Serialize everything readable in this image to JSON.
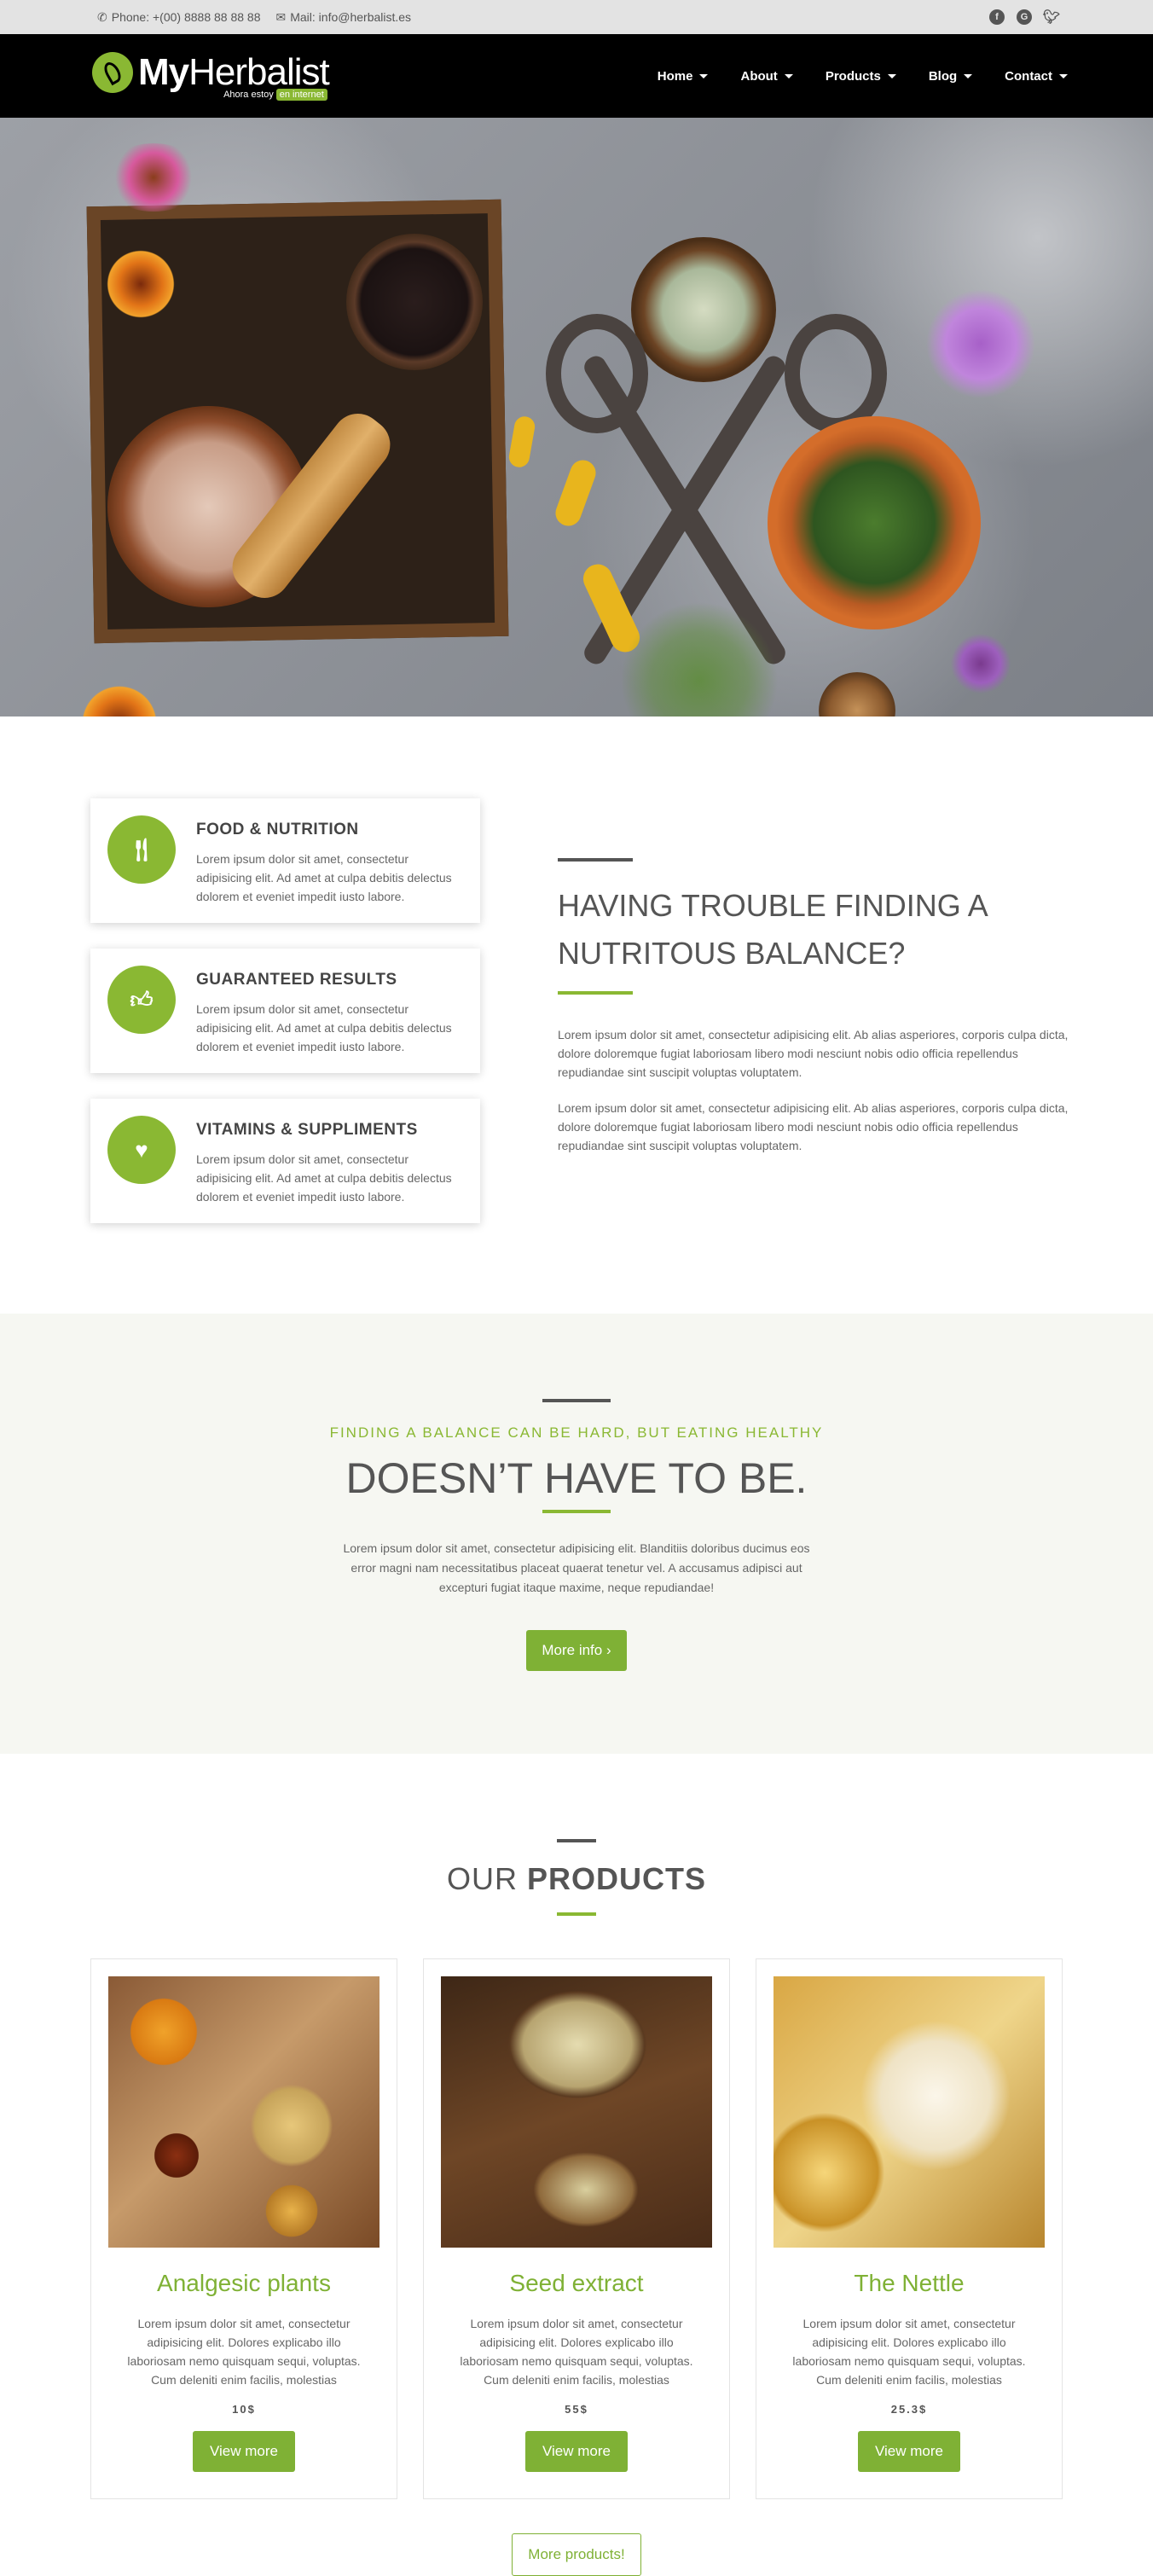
{
  "topbar": {
    "phone": "Phone: +(00) 8888 88 88 88",
    "mail": "Mail: info@herbalist.es"
  },
  "brand": {
    "name_bold": "My",
    "name_light": "Herbalist",
    "tagline": "Ahora estoy",
    "tagline_highlight": "en internet"
  },
  "nav": {
    "items": [
      {
        "label": "Home"
      },
      {
        "label": "About"
      },
      {
        "label": "Products"
      },
      {
        "label": "Blog"
      },
      {
        "label": "Contact"
      }
    ]
  },
  "features": [
    {
      "title": "FOOD & NUTRITION",
      "text": "Lorem ipsum dolor sit amet, consectetur adipisicing elit. Ad amet at culpa debitis delectus dolorem et eveniet impedit iusto labore.",
      "icon": "cutlery-icon"
    },
    {
      "title": "GUARANTEED RESULTS",
      "text": "Lorem ipsum dolor sit amet, consectetur adipisicing elit. Ad amet at culpa debitis delectus dolorem et eveniet impedit iusto labore.",
      "icon": "thumbs-up-icon"
    },
    {
      "title": "VITAMINS & SUPPLIMENTS",
      "text": "Lorem ipsum dolor sit amet, consectetur adipisicing elit. Ad amet at culpa debitis delectus dolorem et eveniet impedit iusto labore.",
      "icon": "heartbeat-icon"
    }
  ],
  "trouble": {
    "heading": "HAVING TROUBLE FINDING A NUTRITOUS BALANCE?",
    "p1": "Lorem ipsum dolor sit amet, consectetur adipisicing elit. Ab alias asperiores, corporis culpa dicta, dolore doloremque fugiat laboriosam libero modi nesciunt nobis odio officia repellendus repudiandae sint suscipit voluptas voluptatem.",
    "p2": "Lorem ipsum dolor sit amet, consectetur adipisicing elit. Ab alias asperiores, corporis culpa dicta, dolore doloremque fugiat laboriosam libero modi nesciunt nobis odio officia repellendus repudiandae sint suscipit voluptas voluptatem."
  },
  "balance": {
    "subtitle": "FINDING A BALANCE CAN BE HARD, BUT EATING HEALTHY",
    "heading": "DOESN’T HAVE TO BE.",
    "text": "Lorem ipsum dolor sit amet, consectetur adipisicing elit. Blanditiis doloribus ducimus eos error magni nam necessitatibus placeat quaerat tenetur vel. A accusamus adipisci aut excepturi fugiat itaque maxime, neque repudiandae!",
    "button": "More info"
  },
  "products": {
    "heading_light": "OUR",
    "heading_bold": "PRODUCTS",
    "items": [
      {
        "name": "Analgesic plants",
        "text": "Lorem ipsum dolor sit amet, consectetur adipisicing elit. Dolores explicabo illo laboriosam nemo quisquam sequi, voluptas. Cum deleniti enim facilis, molestias",
        "price": "10$",
        "button": "View more"
      },
      {
        "name": "Seed extract",
        "text": "Lorem ipsum dolor sit amet, consectetur adipisicing elit. Dolores explicabo illo laboriosam nemo quisquam sequi, voluptas. Cum deleniti enim facilis, molestias",
        "price": "55$",
        "button": "View more"
      },
      {
        "name": "The Nettle",
        "text": "Lorem ipsum dolor sit amet, consectetur adipisicing elit. Dolores explicabo illo laboriosam nemo quisquam sequi, voluptas. Cum deleniti enim facilis, molestias",
        "price": "25.3$",
        "button": "View more"
      }
    ],
    "more_button": "More products!"
  },
  "colors": {
    "accent": "#8ab833",
    "navbar": "#000000",
    "topbar": "#e3e3e3",
    "balance_bg": "#f6f7f2"
  }
}
